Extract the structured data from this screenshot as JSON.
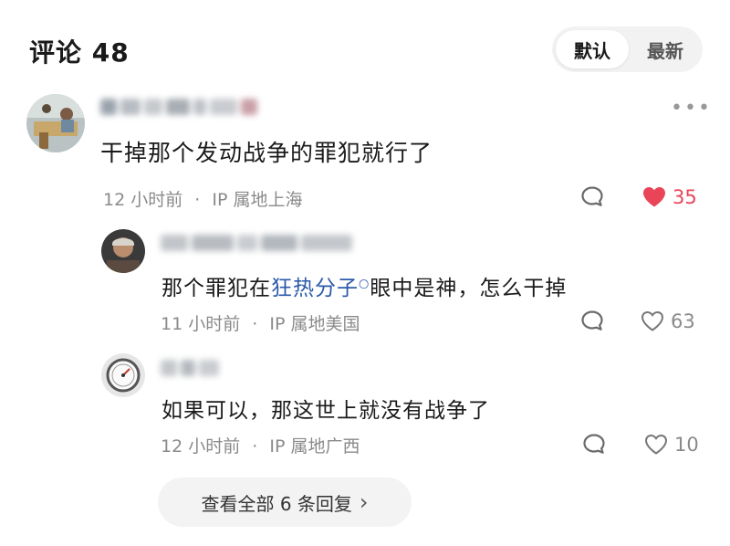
{
  "header": {
    "title": "评论 48",
    "sort_options": [
      "默认",
      "最新"
    ],
    "selected_sort": "默认"
  },
  "main_comment": {
    "text": "干掉那个发动战争的罪犯就行了",
    "time": "12 小时前",
    "separator": "·",
    "ip": "IP 属地上海",
    "likes": "35",
    "liked": true,
    "more_icon": "more-dots-icon"
  },
  "replies": [
    {
      "text_before": "那个罪犯在",
      "link": "狂热分子",
      "text_after": "眼中是神，怎么干掉",
      "time": "11 小时前",
      "separator": "·",
      "ip": "IP 属地美国",
      "likes": "63"
    },
    {
      "text": "如果可以，那这世上就没有战争了",
      "time": "12 小时前",
      "separator": "·",
      "ip": "IP 属地广西",
      "likes": "10"
    }
  ],
  "expand": {
    "label": "查看全部 6 条回复",
    "chevron": "›"
  },
  "colors": {
    "like_active": "#ea4458",
    "link": "#2c5aa8",
    "meta": "#8a8a8a"
  }
}
